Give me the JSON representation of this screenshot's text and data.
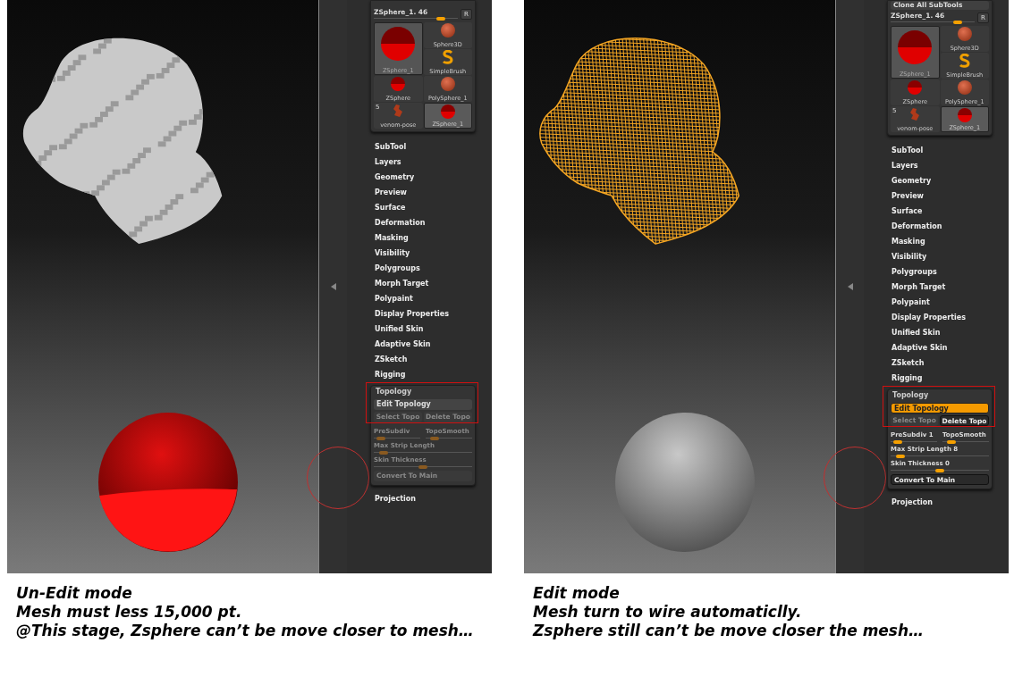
{
  "panels": [
    {
      "viewport": {
        "mesh": {
          "kind": "shaded"
        },
        "sphere": {
          "kind": "red"
        }
      },
      "palette": {
        "tool_name": "ZSphere_1. 46",
        "tool_slider": {
          "level": 0.8
        },
        "r_button": "R",
        "current": "ZSphere_1",
        "thumbs": [
          {
            "label": "Sphere3D",
            "kind": "ball",
            "selected": false
          },
          {
            "label": "SimpleBrush",
            "kind": "brush",
            "selected": false
          },
          {
            "label": "ZSphere",
            "kind": "zsphere",
            "selected": false
          },
          {
            "label": "PolySphere_1",
            "kind": "ball",
            "selected": false
          },
          {
            "label": "venom-pose",
            "kind": "figure",
            "selected": false,
            "badge": "5"
          },
          {
            "label": "ZSphere_1",
            "kind": "zsphere",
            "selected": true
          }
        ],
        "menu": [
          "SubTool",
          "Layers",
          "Geometry",
          "Preview",
          "Surface",
          "Deformation",
          "Masking",
          "Visibility",
          "Polygroups",
          "Morph Target",
          "Polypaint",
          "Display Properties",
          "Unified Skin",
          "Adaptive Skin",
          "ZSketch",
          "Rigging"
        ],
        "topology": {
          "title": "Topology",
          "annotated": true,
          "edit": {
            "label": "Edit Topology",
            "on": false
          },
          "select": {
            "label": "Select Topo",
            "disabled": true
          },
          "delete": {
            "label": "Delete Topo",
            "disabled": true
          },
          "controls_disabled": true,
          "slider_rows": [
            [
              {
                "label": "PreSubdiv",
                "level": 0.15
              },
              {
                "label": "TopoSmooth",
                "level": 0.2
              }
            ],
            [
              {
                "label": "Max Strip Length",
                "level": 0.1
              }
            ],
            [
              {
                "label": "Skin Thickness",
                "level": 0.5
              }
            ]
          ],
          "convert": "Convert To Main"
        },
        "after": "Projection"
      },
      "caption": [
        "Un-Edit mode",
        "Mesh must less 15,000 pt.",
        "@This stage, Zsphere can’t be move closer to mesh…"
      ]
    },
    {
      "viewport": {
        "mesh": {
          "kind": "wire"
        },
        "sphere": {
          "kind": "grey"
        }
      },
      "palette": {
        "clone_button": "Clone All SubTools",
        "tool_name": "ZSphere_1. 46",
        "tool_slider": {
          "level": 0.8
        },
        "r_button": "R",
        "current": "ZSphere_1",
        "thumbs": [
          {
            "label": "Sphere3D",
            "kind": "ball",
            "selected": false
          },
          {
            "label": "SimpleBrush",
            "kind": "brush",
            "selected": false
          },
          {
            "label": "ZSphere",
            "kind": "zsphere",
            "selected": false
          },
          {
            "label": "PolySphere_1",
            "kind": "ball",
            "selected": false
          },
          {
            "label": "venom-pose",
            "kind": "figure",
            "selected": false,
            "badge": "5"
          },
          {
            "label": "ZSphere_1",
            "kind": "zsphere",
            "selected": true
          }
        ],
        "menu": [
          "SubTool",
          "Layers",
          "Geometry",
          "Preview",
          "Surface",
          "Deformation",
          "Masking",
          "Visibility",
          "Polygroups",
          "Morph Target",
          "Polypaint",
          "Display Properties",
          "Unified Skin",
          "Adaptive Skin",
          "ZSketch",
          "Rigging"
        ],
        "topology": {
          "title": "Topology",
          "annotated": true,
          "edit": {
            "label": "Edit Topology",
            "on": true
          },
          "select": {
            "label": "Select Topo",
            "disabled": true
          },
          "delete": {
            "label": "Delete Topo",
            "disabled": false
          },
          "controls_disabled": false,
          "slider_rows": [
            [
              {
                "label": "PreSubdiv 1",
                "level": 0.15
              },
              {
                "label": "TopoSmooth",
                "level": 0.2
              }
            ],
            [
              {
                "label": "Max Strip Length 8",
                "level": 0.1
              }
            ],
            [
              {
                "label": "Skin Thickness 0",
                "level": 0.5
              }
            ]
          ],
          "convert": "Convert To Main"
        },
        "after": "Projection"
      },
      "caption": [
        "Edit mode",
        "Mesh turn to wire automaticlly.",
        "Zsphere still can’t be move closer the mesh…"
      ]
    }
  ]
}
